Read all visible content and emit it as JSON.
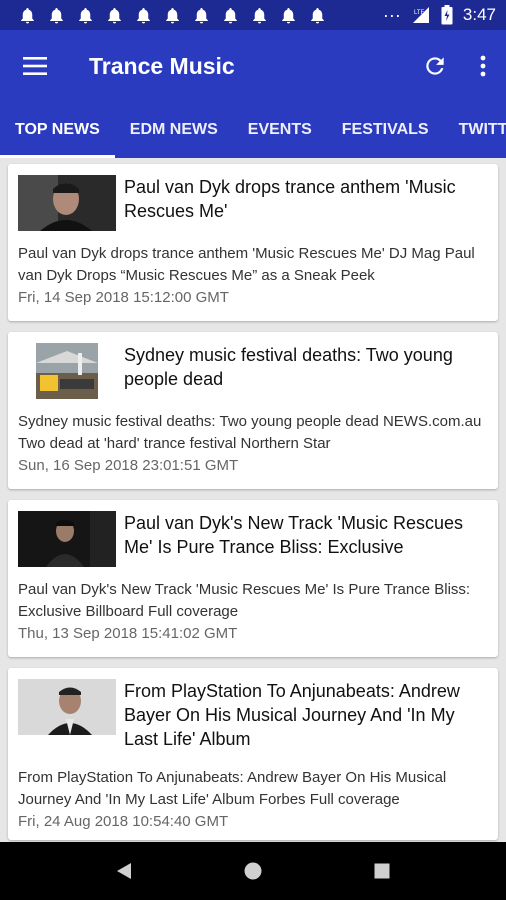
{
  "status": {
    "time": "3:47",
    "notification_icons": [
      "bell-icon",
      "bell-icon",
      "bell-icon",
      "bell-icon",
      "bell-icon",
      "bell-icon",
      "bell-icon",
      "bell-icon",
      "bell-icon",
      "bell-icon",
      "bell-icon"
    ],
    "more_dots": "···",
    "network": "LTE"
  },
  "app_bar": {
    "title": "Trance Music",
    "menu_icon": "hamburger-menu-icon",
    "refresh_icon": "refresh-icon",
    "overflow_icon": "more-vert-icon"
  },
  "tabs": [
    {
      "label": "TOP NEWS",
      "active": true
    },
    {
      "label": "EDM NEWS",
      "active": false
    },
    {
      "label": "EVENTS",
      "active": false
    },
    {
      "label": "FESTIVALS",
      "active": false
    },
    {
      "label": "TWITT",
      "active": false
    }
  ],
  "articles": [
    {
      "title": "Paul van Dyk drops trance anthem 'Music Rescues Me'",
      "description": "Paul van Dyk drops trance anthem 'Music Rescues Me'  DJ Mag  Paul van Dyk Drops “Music Rescues Me” as a Sneak Peek",
      "date": "Fri, 14 Sep 2018 15:12:00 GMT"
    },
    {
      "title": "Sydney music festival deaths: Two young people dead",
      "description": "Sydney music festival deaths: Two young people dead  NEWS.com.au  Two dead at 'hard' trance festival  Northern Star",
      "date": "Sun, 16 Sep 2018 23:01:51 GMT"
    },
    {
      "title": "Paul van Dyk's New Track 'Music Rescues Me' Is Pure Trance Bliss: Exclusive",
      "description": "Paul van Dyk's New Track 'Music Rescues Me' Is Pure Trance Bliss: Exclusive  Billboard  Full coverage",
      "date": "Thu, 13 Sep 2018 15:41:02 GMT"
    },
    {
      "title": "From PlayStation To Anjunabeats: Andrew Bayer On His Musical Journey And 'In My Last Life' Album",
      "description": "From PlayStation To Anjunabeats: Andrew Bayer On His Musical Journey And 'In My Last Life' Album  Forbes  Full coverage",
      "date": "Fri, 24 Aug 2018 10:54:40 GMT"
    }
  ],
  "nav": {
    "back_icon": "back-triangle-icon",
    "home_icon": "home-circle-icon",
    "recents_icon": "recents-square-icon"
  },
  "colors": {
    "status_bar": "#1e2a94",
    "app_bar": "#2b3bbf",
    "background": "#e6e6e6"
  }
}
